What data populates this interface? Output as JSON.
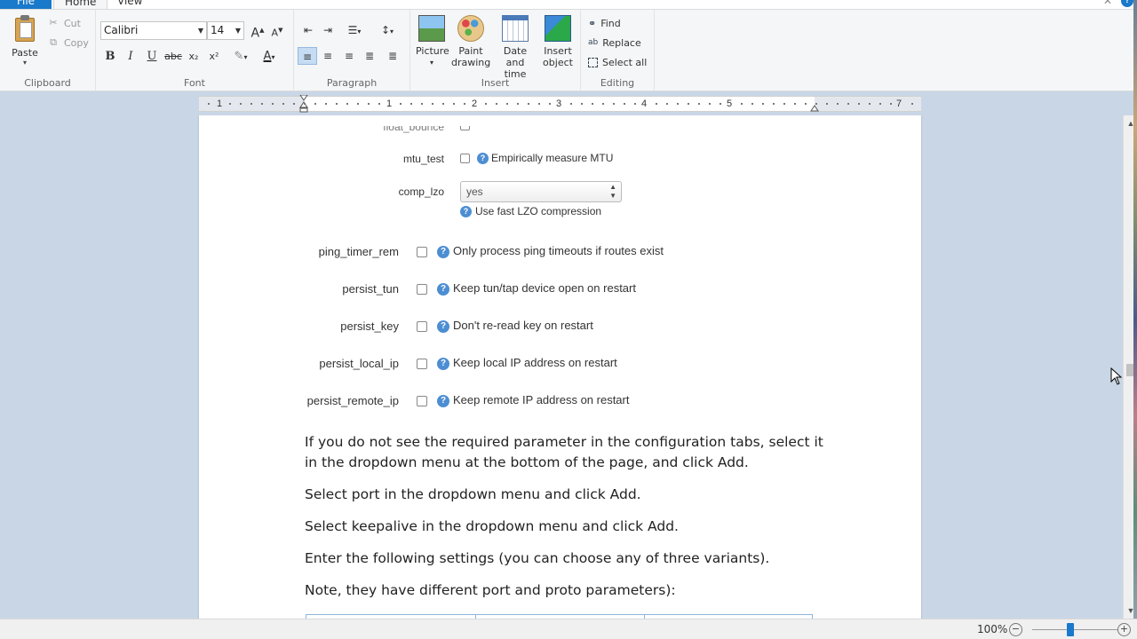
{
  "tabs": [
    {
      "label": "File"
    },
    {
      "label": "Home"
    },
    {
      "label": "View"
    }
  ],
  "clipboard": {
    "paste": "Paste",
    "cut": "Cut",
    "copy": "Copy",
    "group": "Clipboard"
  },
  "font": {
    "name": "Calibri",
    "size": "14",
    "group": "Font",
    "bold": "B",
    "italic": "I",
    "underline": "U",
    "strike": "abc",
    "subscript": "x₂",
    "superscript": "x²",
    "grow": "A",
    "shrink": "A"
  },
  "paragraph": {
    "group": "Paragraph"
  },
  "insert": {
    "group": "Insert",
    "picture": "Picture",
    "paint1": "Paint",
    "paint2": "drawing",
    "date1": "Date and",
    "date2": "time",
    "object1": "Insert",
    "object2": "object"
  },
  "editing": {
    "group": "Editing",
    "find": "Find",
    "replace": "Replace",
    "select_all": "Select all"
  },
  "ruler": [
    "1",
    "1",
    "2",
    "3",
    "4",
    "5",
    "7"
  ],
  "doc": {
    "partial_label": "float_bounce",
    "mtu_label": "mtu_test",
    "mtu_hint": "Empirically measure MTU",
    "comp_label": "comp_lzo",
    "comp_value": "yes",
    "comp_hint": "Use fast LZO compression",
    "rows": [
      {
        "label": "ping_timer_rem",
        "hint": "Only process ping timeouts if routes exist"
      },
      {
        "label": "persist_tun",
        "hint": "Keep tun/tap device open on restart"
      },
      {
        "label": "persist_key",
        "hint": "Don't re-read key on restart"
      },
      {
        "label": "persist_local_ip",
        "hint": "Keep local IP address on restart"
      },
      {
        "label": "persist_remote_ip",
        "hint": "Keep remote IP address on restart"
      }
    ],
    "p1a": "If you do not see the required parameter in the configuration tabs, select it",
    "p1b": "in the dropdown menu at the bottom of the page, and click Add.",
    "p2": "Select port in the dropdown menu and click Add.",
    "p3": "Select keepalive in the dropdown menu and click Add.",
    "p4": "Enter the following settings (you can choose any of three variants).",
    "p5": "Note, they have different port and proto parameters):"
  },
  "status": {
    "zoom": "100%",
    "zoom_out": "−",
    "zoom_in": "+"
  },
  "colors": {
    "accent": "#1979ca",
    "workspace": "#c9d6e6",
    "info_icon": "#4d8ed3"
  }
}
